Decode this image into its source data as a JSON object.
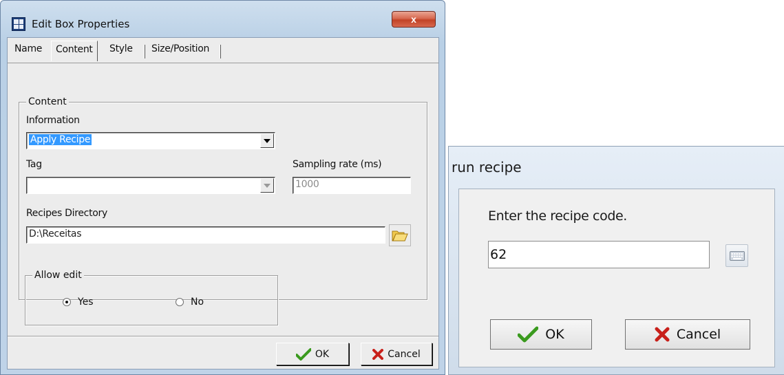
{
  "edit_dialog": {
    "title": "Edit Box Properties",
    "close_label": "x",
    "tabs": [
      {
        "label": "Name",
        "active": false
      },
      {
        "label": "Content",
        "active": true
      },
      {
        "label": "Style",
        "active": false
      },
      {
        "label": "Size/Position",
        "active": false
      }
    ],
    "content_group": {
      "legend": "Content",
      "information_label": "Information",
      "information_value": "Apply Recipe",
      "tag_label": "Tag",
      "tag_value": "",
      "sampling_rate_label": "Sampling rate (ms)",
      "sampling_rate_value": "1000",
      "recipes_directory_label": "Recipes Directory",
      "recipes_directory_value": "D:\\Receitas"
    },
    "allow_edit_group": {
      "legend": "Allow edit",
      "options": [
        {
          "label": "Yes",
          "selected": true
        },
        {
          "label": "No",
          "selected": false
        }
      ]
    },
    "ok_label": "OK",
    "cancel_label": "Cancel"
  },
  "run_recipe_dialog": {
    "title": "run recipe",
    "prompt": "Enter the recipe code.",
    "code_value": "62",
    "ok_label": "OK",
    "cancel_label": "Cancel"
  },
  "colors": {
    "ok_check": "#3a9a1e",
    "cancel_x": "#c8201a",
    "selection": "#3399ff",
    "close_button": "#c8452b"
  },
  "icons": [
    "app-icon",
    "close-icon",
    "dropdown-arrow-icon",
    "folder-icon",
    "checkmark-icon",
    "cancel-x-icon",
    "keyboard-icon"
  ]
}
